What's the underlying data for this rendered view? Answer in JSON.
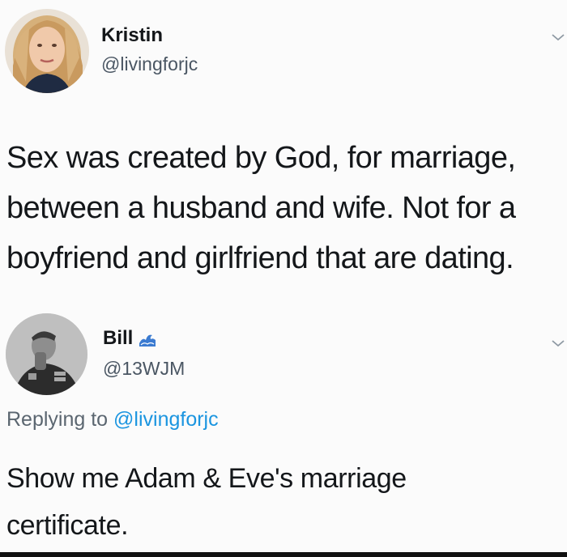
{
  "tweet1": {
    "name": "Kristin",
    "handle": "@livingforjc",
    "text_lines": [
      "Sex was created by God, for marriage,",
      "between a husband and wife. Not for a",
      "boyfriend and girlfriend that are dating."
    ],
    "avatar_icon": "profile-photo-woman",
    "menu_icon": "chevron-down-icon"
  },
  "tweet2": {
    "name": "Bill",
    "name_emoji": "wave-icon",
    "handle": "@13WJM",
    "replying_prefix": "Replying to ",
    "replying_mention": "@livingforjc",
    "text_lines": [
      "Show me Adam & Eve's marriage",
      "certificate."
    ],
    "avatar_icon": "profile-photo-man",
    "menu_icon": "chevron-down-icon"
  },
  "colors": {
    "text": "#14171a",
    "secondary": "#4a5663",
    "link": "#1b95e0",
    "background": "#fbfbfb"
  }
}
